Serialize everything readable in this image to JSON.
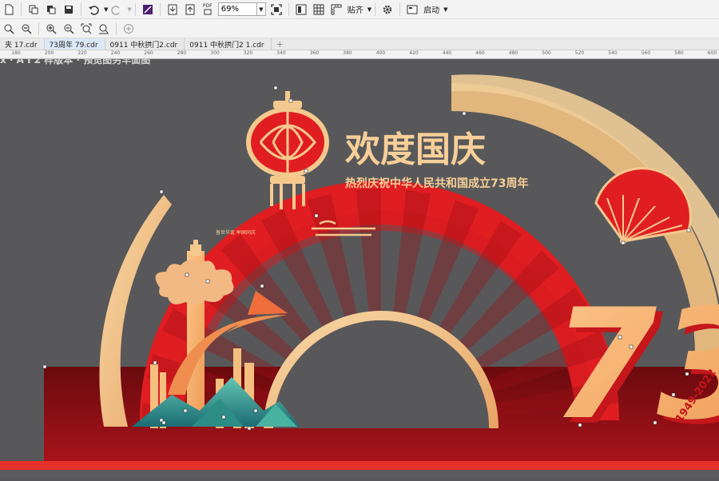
{
  "toolbar": {
    "zoom_value": "69%",
    "snap_label": "贴齐",
    "launch_label": "启动",
    "pdf_label": "PDF",
    "icons": [
      "new-icon",
      "open-icon",
      "save-icon",
      "undo-icon",
      "redo-icon",
      "corel-connect-icon",
      "import-icon",
      "export-icon",
      "publish-pdf-icon",
      "full-screen-icon",
      "wireframe-icon",
      "grid-icon",
      "rulers-icon",
      "settings-icon",
      "launcher-icon",
      "zoom-in-icon",
      "zoom-out-icon",
      "zoom-fit-icon",
      "zoom-page-icon",
      "add-page-icon"
    ]
  },
  "tabs": [
    {
      "label": "夹 17.cdr"
    },
    {
      "label": "73周年 79.cdr"
    },
    {
      "label": "0911 中秋拱门2.cdr"
    },
    {
      "label": "0911 中秋拱门2 1.cdr"
    }
  ],
  "ruler": {
    "ticks": [
      "180",
      "200",
      "220",
      "240",
      "260",
      "280",
      "300",
      "320",
      "340",
      "360",
      "380",
      "400",
      "420",
      "440",
      "460",
      "480",
      "500",
      "520",
      "540",
      "560",
      "580",
      "600"
    ]
  },
  "design": {
    "top_note": "x · A I 2 样版本 · 预览图另丰面图",
    "title": "欢度国庆",
    "subtitle": "热烈庆祝中华人民共和国成立73周年",
    "small_line": "普世华诞 举国同庆",
    "big_number": "73",
    "years": "1949-2022",
    "colors": {
      "red": "#e01e22",
      "dark_red": "#8c0e12",
      "gold": "#f2c58e",
      "orange": "#f0a35e",
      "teal": "#2a8f8a"
    }
  }
}
